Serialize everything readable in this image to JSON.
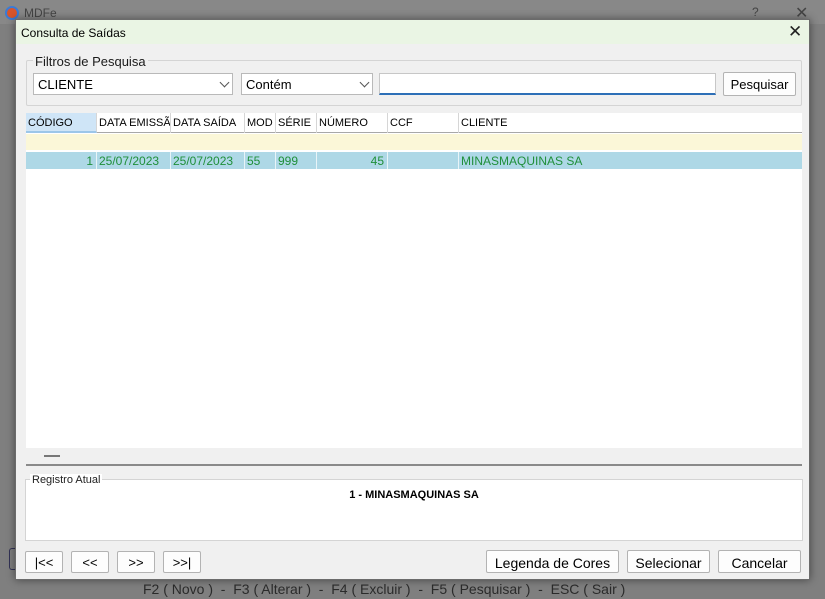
{
  "background_window": {
    "title": "MDFe",
    "help": "?",
    "close": "✕",
    "footer": "F2 ( Novo )  -  F3 ( Alterar )  -  F4 ( Excluir )  -  F5 ( Pesquisar )  -  ESC ( Sair )"
  },
  "dialog": {
    "title": "Consulta de Saídas",
    "close": "✕"
  },
  "filters": {
    "legend": "Filtros de Pesquisa",
    "field": "CLIENTE",
    "operator": "Contém",
    "search_value": "",
    "search_button": "Pesquisar"
  },
  "grid": {
    "columns": [
      "CÓDIGO",
      "DATA EMISSÃO",
      "DATA SAÍDA",
      "MOD",
      "SÉRIE",
      "NÚMERO",
      "CCF",
      "CLIENTE"
    ],
    "rows": [
      {
        "codigo": "1",
        "data_emissao": "25/07/2023",
        "data_saida": "25/07/2023",
        "mod": "55",
        "serie": "999",
        "numero": "45",
        "ccf": "",
        "cliente": "MINASMAQUINAS SA"
      }
    ],
    "selected_row_color": "#aed8e6",
    "text_color": "#1f8f3a"
  },
  "current_record": {
    "legend": "Registro Atual",
    "value": "1 - MINASMAQUINAS SA"
  },
  "navigation": {
    "first": "|<<",
    "prev": "<<",
    "next": ">>",
    "last": ">>|"
  },
  "actions": {
    "legend_button": "Legenda de Cores",
    "select_button": "Selecionar",
    "cancel_button": "Cancelar"
  }
}
